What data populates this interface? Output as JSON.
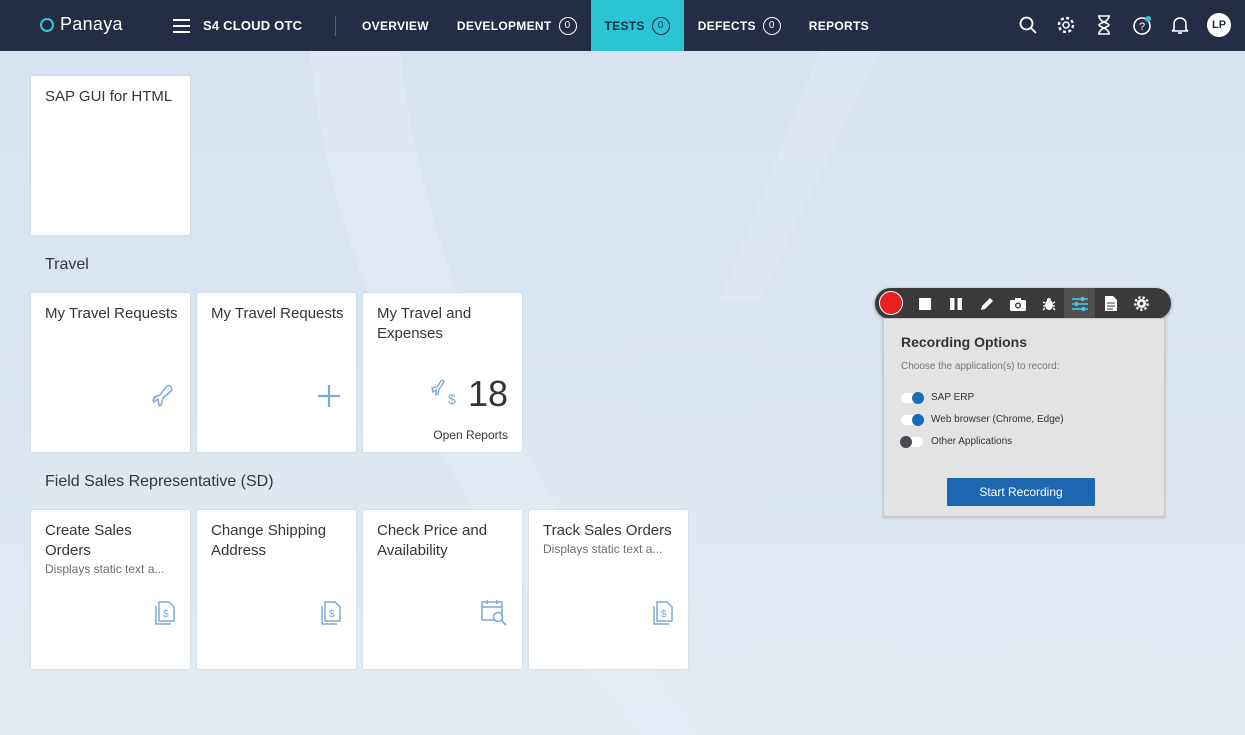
{
  "header": {
    "logo": "Panaya",
    "project": "S4 CLOUD OTC",
    "nav": [
      {
        "label": "OVERVIEW",
        "badge": null
      },
      {
        "label": "DEVELOPMENT",
        "badge": "0"
      },
      {
        "label": "TESTS",
        "badge": "0",
        "active": true
      },
      {
        "label": "DEFECTS",
        "badge": "0"
      },
      {
        "label": "REPORTS",
        "badge": null
      }
    ],
    "icons": [
      "search-icon",
      "gear-icon",
      "hourglass-icon",
      "help-icon",
      "bell-icon"
    ],
    "avatar": "LP",
    "accent": "#2bc4d4",
    "bar_color": "#252c45"
  },
  "tiles": {
    "sap_gui": {
      "title": "SAP GUI for HTML"
    },
    "travel_group": "Travel",
    "travel": [
      {
        "title": "My Travel Requests",
        "icon": "airplane-icon"
      },
      {
        "title": "My Travel Requests",
        "icon": "plus-icon"
      },
      {
        "title": "My Travel and Expenses",
        "kpi": "18",
        "kpi_label": "Open Reports",
        "icon": "travel-expense-icon"
      }
    ],
    "sales_group": "Field Sales Representative (SD)",
    "sales": [
      {
        "title": "Create Sales Orders",
        "subtitle": "Displays static text a...",
        "icon": "document-dollar-icon"
      },
      {
        "title": "Change Shipping Address",
        "subtitle": "",
        "icon": "document-dollar-icon"
      },
      {
        "title": "Check Price and Availability",
        "subtitle": "",
        "icon": "calendar-search-icon"
      },
      {
        "title": "Track Sales Orders",
        "subtitle": "Displays static text a...",
        "icon": "document-dollar-icon"
      }
    ]
  },
  "recorder": {
    "tools": [
      "stop-icon",
      "pause-icon",
      "pen-icon",
      "camera-icon",
      "bug-icon",
      "settings-sliders-icon",
      "document-icon",
      "cog-icon"
    ],
    "panel_title": "Recording Options",
    "panel_subtitle": "Choose the application(s) to record:",
    "options": [
      {
        "label": "SAP ERP",
        "on": true
      },
      {
        "label": "Web browser (Chrome, Edge)",
        "on": true
      },
      {
        "label": "Other Applications",
        "on": false
      }
    ],
    "start_label": "Start Recording",
    "record_color": "#e82020",
    "button_color": "#1c67b0"
  }
}
